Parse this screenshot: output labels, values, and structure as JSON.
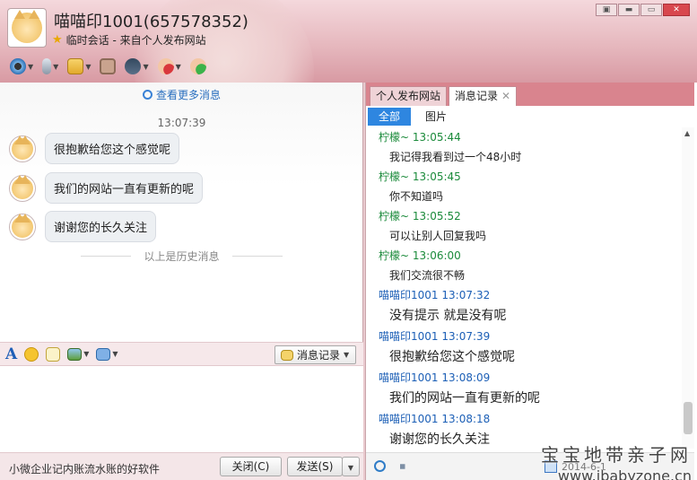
{
  "header": {
    "title": "喵喵印1001(657578352)",
    "subtitle": "临时会话 - 来自个人发布网站",
    "window_buttons": [
      "▣",
      "▬",
      "▭",
      "✕"
    ]
  },
  "toolbar": {
    "icons": [
      "webcam-icon",
      "microphone-icon",
      "file-transfer-icon",
      "screen-share-icon",
      "remote-assist-icon",
      "block-user-icon",
      "add-friend-icon"
    ]
  },
  "chat": {
    "more_messages": "查看更多消息",
    "time": "13:07:39",
    "messages": [
      {
        "text": "很抱歉给您这个感觉呢"
      },
      {
        "text": "我们的网站一直有更新的呢"
      },
      {
        "text": "谢谢您的长久关注"
      }
    ],
    "history_divider": "以上是历史消息"
  },
  "compose_bar": {
    "records_button": "消息记录"
  },
  "bottom": {
    "ad_text": "小微企业记内账流水账的好软件",
    "close_button": "关闭(C)",
    "send_button": "发送(S)"
  },
  "right_panel": {
    "tabs": [
      {
        "label": "个人发布网站"
      },
      {
        "label": "消息记录"
      }
    ],
    "filters": [
      "全部",
      "图片"
    ],
    "records": [
      {
        "sender": "柠檬~",
        "time": "13:05:44",
        "text": "我记得我看到过一个48小时",
        "self": false
      },
      {
        "sender": "柠檬~",
        "time": "13:05:45",
        "text": "你不知道吗",
        "self": false
      },
      {
        "sender": "柠檬~",
        "time": "13:05:52",
        "text": "可以让别人回复我吗",
        "self": false
      },
      {
        "sender": "柠檬~",
        "time": "13:06:00",
        "text": "我们交流很不畅",
        "self": false
      },
      {
        "sender": "喵喵印1001",
        "time": "13:07:32",
        "text": "没有提示 就是没有呢",
        "self": true
      },
      {
        "sender": "喵喵印1001",
        "time": "13:07:39",
        "text": "很抱歉给您这个感觉呢",
        "self": true
      },
      {
        "sender": "喵喵印1001",
        "time": "13:08:09",
        "text": "我们的网站一直有更新的呢",
        "self": true
      },
      {
        "sender": "喵喵印1001",
        "time": "13:08:18",
        "text": "谢谢您的长久关注",
        "self": true
      }
    ],
    "date": "2014-6-1"
  },
  "watermark": {
    "line1": "宝宝地带亲子网",
    "line2": "www.ibabyzone.cn"
  },
  "colors": {
    "accent": "#2e86e0",
    "header_pink": "#d89aa3",
    "other_sender": "#1a8a3a",
    "self_sender": "#1c5fb6"
  }
}
